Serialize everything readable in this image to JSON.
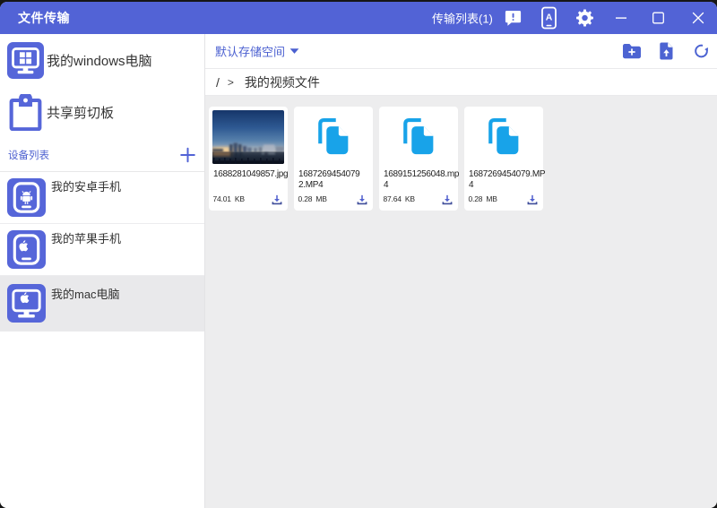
{
  "window": {
    "title": "文件传输",
    "transfer_list_label": "传输列表(1)",
    "controls": {
      "minimize": "minimize",
      "maximize": "maximize",
      "close": "close"
    },
    "titlebar_icons": [
      "feedback-icon",
      "phone-connect-icon",
      "settings-gear-icon"
    ]
  },
  "sidebar": {
    "items": [
      {
        "label": "我的windows电脑",
        "icon": "windows-computer-icon"
      },
      {
        "label": "共享剪切板",
        "icon": "clipboard-icon"
      }
    ],
    "device_section": {
      "title": "设备列表",
      "add_icon": "plus-icon"
    },
    "devices": [
      {
        "label": "我的安卓手机",
        "icon": "android-phone-icon",
        "selected": false
      },
      {
        "label": "我的苹果手机",
        "icon": "apple-phone-icon",
        "selected": false
      },
      {
        "label": "我的mac电脑",
        "icon": "mac-computer-icon",
        "selected": true
      }
    ]
  },
  "toolbar": {
    "storage_selector": "默认存储空间",
    "icons": [
      "new-folder-icon",
      "upload-file-icon",
      "refresh-icon"
    ]
  },
  "breadcrumb": {
    "root": "/",
    "separator": ">",
    "current": "我的视频文件"
  },
  "files": [
    {
      "name": "1688281049857.jpg",
      "name_lines": [
        "1688281049857.jpg",
        ""
      ],
      "size": "74.01 KB",
      "kind": "image-thumbnail"
    },
    {
      "name": "16872694540792.MP4",
      "name_lines": [
        "1687269454079",
        "2.MP4"
      ],
      "size": "0.28 MB",
      "kind": "document"
    },
    {
      "name": "1689151256048.mp4",
      "name_lines": [
        "1689151256048.mp",
        "4"
      ],
      "size": "87.64 KB",
      "kind": "document"
    },
    {
      "name": "1687269454079.MP4",
      "name_lines": [
        "1687269454079.MP",
        "4"
      ],
      "size": "0.28 MB",
      "kind": "document"
    }
  ],
  "colors": {
    "titlebar": "#5263d6",
    "accent_indigo": "#5666d9",
    "doc_icon_azure": "#18a3e9",
    "main_background": "#ededee",
    "selected_row": "#e9e9eb"
  }
}
